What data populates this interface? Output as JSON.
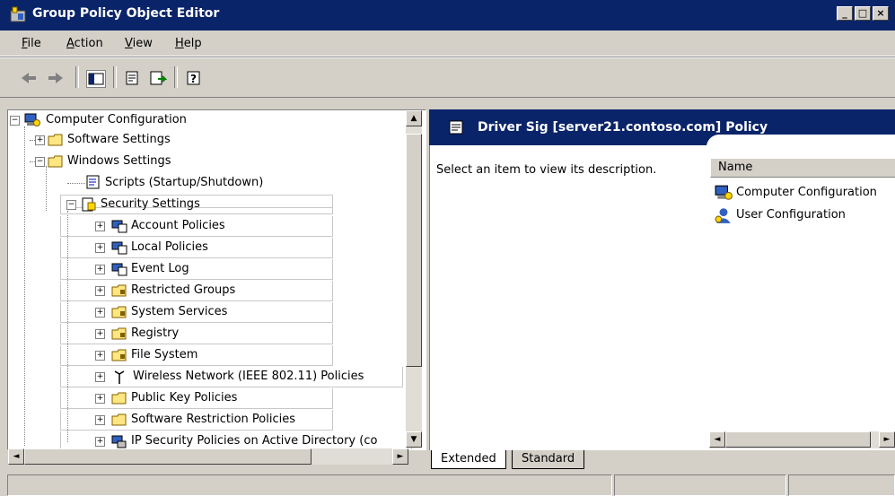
{
  "window": {
    "title": "Group Policy Object Editor"
  },
  "menu": [
    {
      "label": "File",
      "key": "F"
    },
    {
      "label": "Action",
      "key": "A"
    },
    {
      "label": "View",
      "key": "V"
    },
    {
      "label": "Help",
      "key": "H"
    }
  ],
  "tree": {
    "root": "Computer Configuration",
    "software_settings": "Software Settings",
    "windows_settings": "Windows Settings",
    "scripts": "Scripts (Startup/Shutdown)",
    "security_settings": "Security Settings",
    "account_policies": "Account Policies",
    "local_policies": "Local Policies",
    "event_log": "Event Log",
    "restricted_groups": "Restricted Groups",
    "system_services": "System Services",
    "registry": "Registry",
    "file_system": "File System",
    "wireless": "Wireless Network (IEEE 802.11) Policies",
    "public_key": "Public Key Policies",
    "software_restriction": "Software Restriction Policies",
    "ip_security": "IP Security Policies on Active Directory (co"
  },
  "right_pane": {
    "title": "Driver Sig [server21.contoso.com] Policy",
    "description": "Select an item to view its description.",
    "column_name": "Name",
    "items": [
      "Computer Configuration",
      "User Configuration"
    ]
  },
  "tabs": [
    "Extended",
    "Standard"
  ],
  "colors": {
    "title_bar": "#0a246a",
    "chrome": "#d4d0c8"
  }
}
